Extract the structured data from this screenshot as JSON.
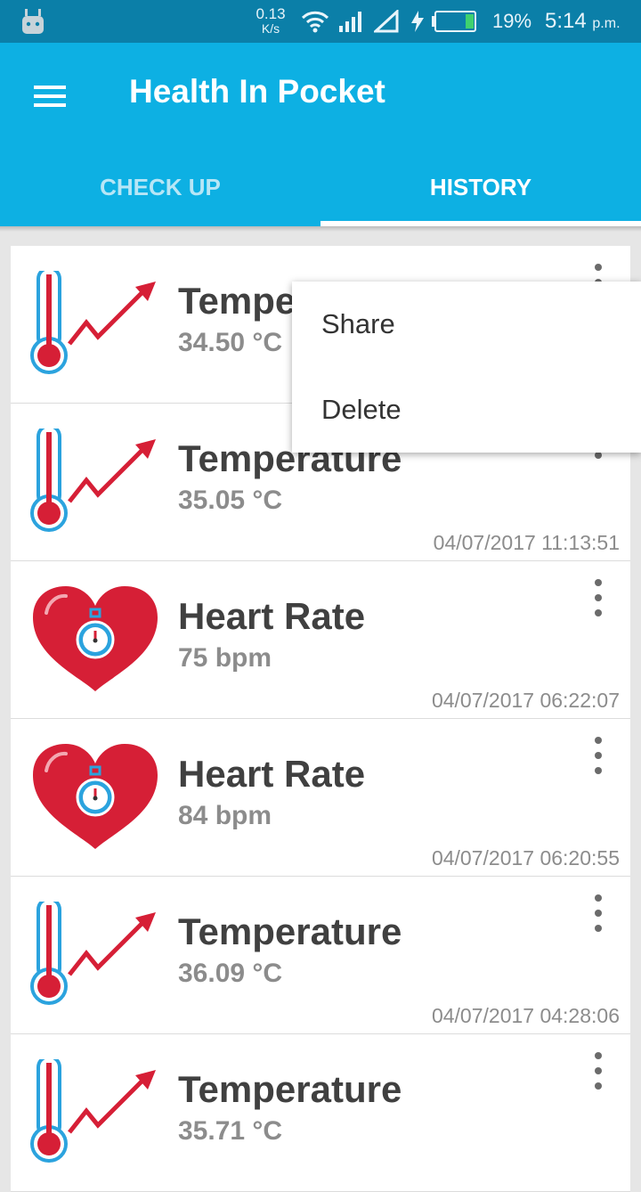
{
  "status_bar": {
    "speed_value": "0.13",
    "speed_unit": "K/s",
    "battery_percent": "19%",
    "time": "5:14",
    "ampm": "p.m.",
    "icons": [
      "android-notification-icon",
      "wifi-icon",
      "cell-signal-icon",
      "no-signal-icon",
      "charging-icon",
      "battery-icon"
    ]
  },
  "app_bar": {
    "title": "Health In Pocket",
    "menu_icon": "hamburger-menu-icon",
    "tabs": [
      {
        "label": "CHECK UP",
        "selected": false
      },
      {
        "label": "HISTORY",
        "selected": true
      }
    ]
  },
  "colors": {
    "status_bar": "#0b7fa8",
    "app_bar": "#0db0e3",
    "accent_red": "#d61f36",
    "accent_blue": "#2ba3de"
  },
  "history": [
    {
      "type": "temperature",
      "icon": "thermometer-trend-icon",
      "title": "Temperature",
      "value": "34.50 °C",
      "timestamp": ""
    },
    {
      "type": "temperature",
      "icon": "thermometer-trend-icon",
      "title": "Temperature",
      "value": "35.05 °C",
      "timestamp": "04/07/2017 11:13:51"
    },
    {
      "type": "heart_rate",
      "icon": "heart-stopwatch-icon",
      "title": "Heart Rate",
      "value": "75 bpm",
      "timestamp": "04/07/2017 06:22:07"
    },
    {
      "type": "heart_rate",
      "icon": "heart-stopwatch-icon",
      "title": "Heart Rate",
      "value": "84 bpm",
      "timestamp": "04/07/2017 06:20:55"
    },
    {
      "type": "temperature",
      "icon": "thermometer-trend-icon",
      "title": "Temperature",
      "value": "36.09 °C",
      "timestamp": "04/07/2017 04:28:06"
    },
    {
      "type": "temperature",
      "icon": "thermometer-trend-icon",
      "title": "Temperature",
      "value": "35.71 °C",
      "timestamp": ""
    }
  ],
  "popup_menu": {
    "items": [
      {
        "label": "Share"
      },
      {
        "label": "Delete"
      }
    ]
  }
}
